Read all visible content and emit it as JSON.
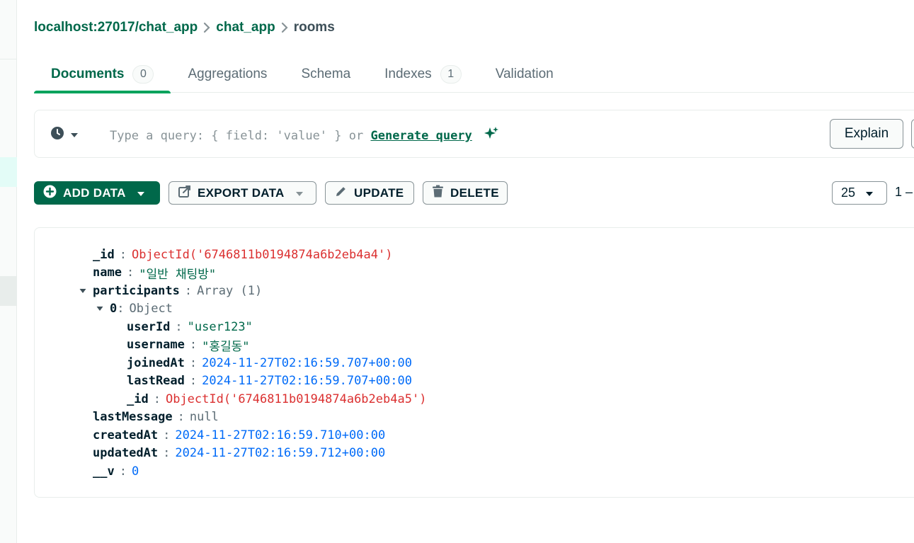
{
  "breadcrumb": {
    "host": "localhost:27017/chat_app",
    "database": "chat_app",
    "collection": "rooms"
  },
  "tabs": [
    {
      "label": "Documents",
      "count": "0"
    },
    {
      "label": "Aggregations"
    },
    {
      "label": "Schema"
    },
    {
      "label": "Indexes",
      "count": "1"
    },
    {
      "label": "Validation"
    }
  ],
  "query": {
    "placeholder": "Type a query: { field: 'value' } or",
    "generate_link": "Generate query",
    "explain_label": "Explain"
  },
  "toolbar": {
    "add_data": "ADD DATA",
    "export_data": "EXPORT DATA",
    "update": "UPDATE",
    "delete": "DELETE",
    "page_size": "25",
    "range": "1 –"
  },
  "document": {
    "id_key": "_id",
    "id_value": "ObjectId('6746811b0194874a6b2eb4a4')",
    "name_key": "name",
    "name_value": "\"일반 채팅방\"",
    "participants_key": "participants",
    "participants_value": "Array (1)",
    "item0_key": "0",
    "item0_value": "Object",
    "userId_key": "userId",
    "userId_value": "\"user123\"",
    "username_key": "username",
    "username_value": "\"홍길동\"",
    "joinedAt_key": "joinedAt",
    "joinedAt_value": "2024-11-27T02:16:59.707+00:00",
    "lastRead_key": "lastRead",
    "lastRead_value": "2024-11-27T02:16:59.707+00:00",
    "item_id_key": "_id",
    "item_id_value": "ObjectId('6746811b0194874a6b2eb4a5')",
    "lastMessage_key": "lastMessage",
    "lastMessage_value": "null",
    "createdAt_key": "createdAt",
    "createdAt_value": "2024-11-27T02:16:59.710+00:00",
    "updatedAt_key": "updatedAt",
    "updatedAt_value": "2024-11-27T02:16:59.712+00:00",
    "v_key": "__v",
    "v_value": "0"
  },
  "colors": {
    "brand_green": "#00684a",
    "accent_green": "#00a35c",
    "objectid_red": "#db3030",
    "date_blue": "#016bf8"
  },
  "icons": [
    "clock-icon",
    "chevron-down-icon",
    "sparkle-icon",
    "plus-circle-icon",
    "export-icon",
    "pencil-icon",
    "trash-icon",
    "chevron-right-icon",
    "caret-down-icon"
  ]
}
